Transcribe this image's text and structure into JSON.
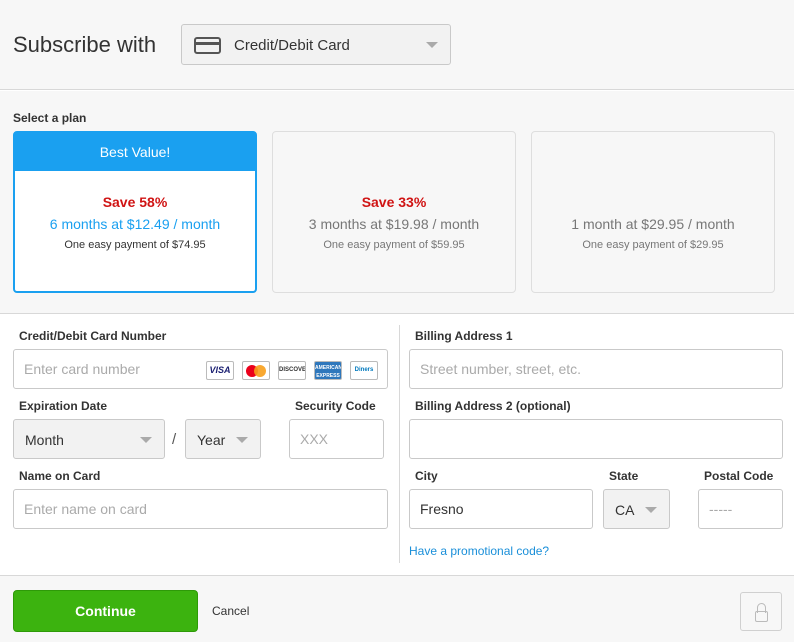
{
  "header": {
    "title": "Subscribe with",
    "payment_method": {
      "selected": "Credit/Debit Card",
      "icon": "credit-card-icon"
    }
  },
  "plans": {
    "label": "Select a plan",
    "items": [
      {
        "banner": "Best Value!",
        "save": "Save 58%",
        "price": "6 months at $12.49 / month",
        "payment": "One easy payment of $74.95",
        "selected": true
      },
      {
        "banner": "",
        "save": "Save 33%",
        "price": "3 months at $19.98 / month",
        "payment": "One easy payment of $59.95",
        "selected": false
      },
      {
        "banner": "",
        "save": "",
        "price": "1 month at $29.95 / month",
        "payment": "One easy payment of $29.95",
        "selected": false
      }
    ],
    "accent_color": "#1aa0f0",
    "save_color": "#d01414"
  },
  "form": {
    "card_number": {
      "label": "Credit/Debit Card Number",
      "value": "",
      "placeholder": "Enter card number"
    },
    "card_brands": [
      {
        "name": "visa-icon",
        "text": "VISA"
      },
      {
        "name": "mastercard-icon",
        "text": ""
      },
      {
        "name": "discover-icon",
        "text": "DISCOVER"
      },
      {
        "name": "amex-icon",
        "text": "AMERICAN EXPRESS"
      },
      {
        "name": "diners-club-icon",
        "text": "Diners"
      }
    ],
    "expiration": {
      "label": "Expiration Date",
      "month": "Month",
      "separator": "/",
      "year": "Year"
    },
    "security_code": {
      "label": "Security Code",
      "value": "",
      "placeholder": "XXX"
    },
    "name_on_card": {
      "label": "Name on Card",
      "value": "",
      "placeholder": "Enter name on card"
    },
    "billing_address_1": {
      "label": "Billing Address 1",
      "value": "",
      "placeholder": "Street number, street, etc."
    },
    "billing_address_2": {
      "label": "Billing Address 2 (optional)",
      "value": "",
      "placeholder": ""
    },
    "city": {
      "label": "City",
      "value": "Fresno",
      "placeholder": ""
    },
    "state": {
      "label": "State",
      "value": "CA"
    },
    "postal_code": {
      "label": "Postal Code",
      "value": "",
      "placeholder": "-----"
    },
    "promo_link": "Have a promotional code?"
  },
  "footer": {
    "continue_label": "Continue",
    "cancel_label": "Cancel",
    "continue_color": "#3cb30f",
    "lock_icon": "lock-icon"
  }
}
